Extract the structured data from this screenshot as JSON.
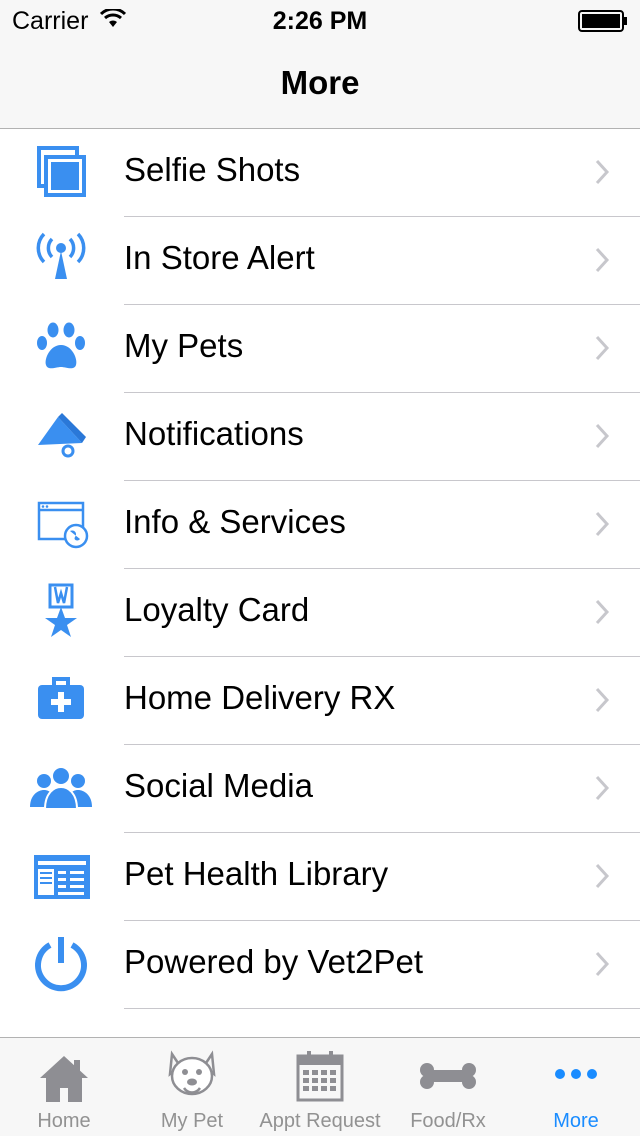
{
  "status_bar": {
    "carrier": "Carrier",
    "time": "2:26 PM"
  },
  "nav": {
    "title": "More"
  },
  "accent_color": "#3a8ff0",
  "menu": {
    "items": [
      {
        "label": "Selfie Shots",
        "icon": "photos-icon"
      },
      {
        "label": "In Store Alert",
        "icon": "antenna-icon"
      },
      {
        "label": "My Pets",
        "icon": "paw-icon"
      },
      {
        "label": "Notifications",
        "icon": "megaphone-icon"
      },
      {
        "label": "Info & Services",
        "icon": "browser-globe-icon"
      },
      {
        "label": "Loyalty Card",
        "icon": "star-medal-icon"
      },
      {
        "label": "Home Delivery RX",
        "icon": "medical-kit-icon"
      },
      {
        "label": "Social Media",
        "icon": "people-icon"
      },
      {
        "label": "Pet Health Library",
        "icon": "newspaper-icon"
      },
      {
        "label": "Powered by Vet2Pet",
        "icon": "power-icon"
      }
    ]
  },
  "tabs": [
    {
      "label": "Home",
      "icon": "home-icon"
    },
    {
      "label": "My Pet",
      "icon": "dog-face-icon"
    },
    {
      "label": "Appt Request",
      "icon": "calendar-icon"
    },
    {
      "label": "Food/Rx",
      "icon": "bone-icon"
    },
    {
      "label": "More",
      "icon": "more-dots-icon",
      "active": true
    }
  ]
}
